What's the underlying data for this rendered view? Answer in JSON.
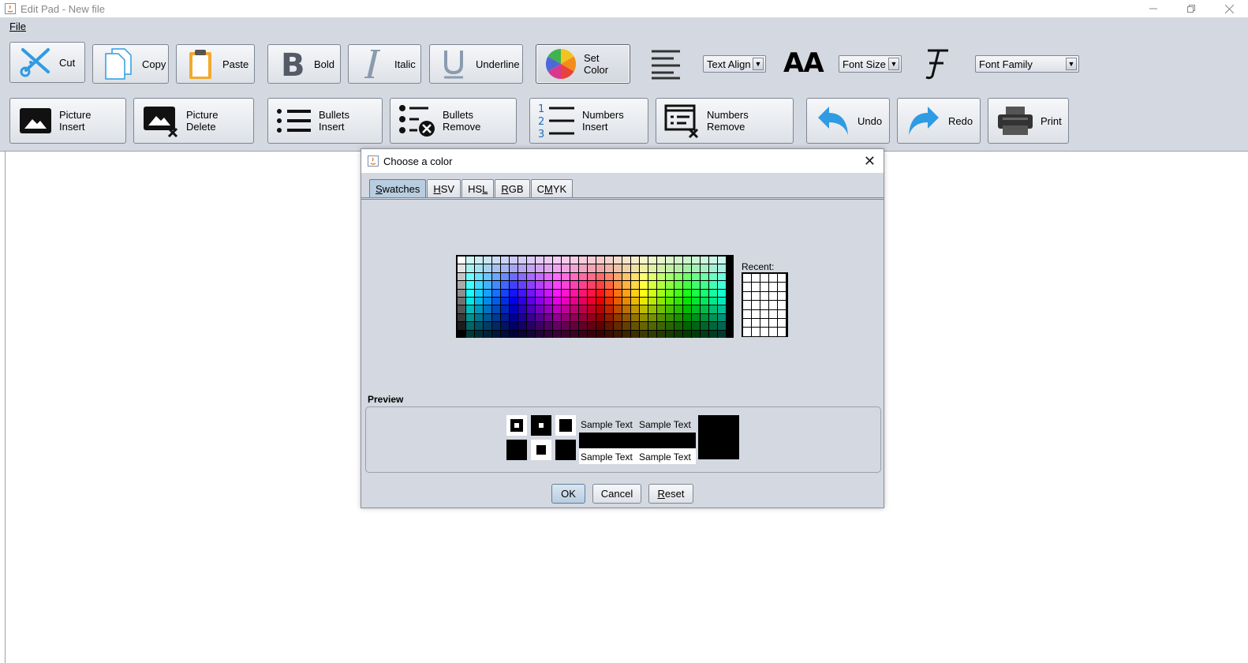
{
  "window": {
    "title": "Edit Pad - New file",
    "controls": [
      "minimize",
      "restore",
      "close"
    ]
  },
  "menubar": {
    "items": [
      {
        "label": "File"
      }
    ]
  },
  "toolbar_row1": {
    "cut": "Cut",
    "copy": "Copy",
    "paste": "Paste",
    "bold": "Bold",
    "italic": "Italic",
    "underline": "Underline",
    "set_color": "Set Color",
    "text_align": "Text Align",
    "font_size_glyph": "AA",
    "font_size": "Font Size",
    "font_family": "Font Family"
  },
  "toolbar_row2": {
    "picture_insert": "Picture Insert",
    "picture_delete": "Picture Delete",
    "bullets_insert": "Bullets Insert",
    "bullets_remove": "Bullets Remove",
    "numbers_insert": "Numbers Insert",
    "numbers_remove": "Numbers Remove",
    "undo": "Undo",
    "redo": "Redo",
    "print": "Print"
  },
  "dialog": {
    "title": "Choose a color",
    "tabs": [
      {
        "label": "Swatches",
        "mnemonic": "S",
        "rest": "watches",
        "active": true
      },
      {
        "label": "HSV",
        "mnemonic": "H",
        "rest": "SV"
      },
      {
        "label": "HSL",
        "pre": "HS",
        "mnemonic": "L"
      },
      {
        "label": "RGB",
        "mnemonic": "R",
        "rest": "GB"
      },
      {
        "label": "CMYK",
        "pre": "C",
        "mnemonic": "M",
        "rest": "YK"
      }
    ],
    "recent_label": "Recent:",
    "preview_label": "Preview",
    "sample_text": "Sample Text",
    "ok": "OK",
    "cancel": "Cancel",
    "reset": "Reset",
    "reset_mnemonic": "R",
    "reset_rest": "eset",
    "selected_color": "#000000"
  },
  "colors": {
    "toolbar_bg": "#d4d8e0",
    "accent_blue": "#2f9be3",
    "icon_dark": "#1a1a1a"
  }
}
